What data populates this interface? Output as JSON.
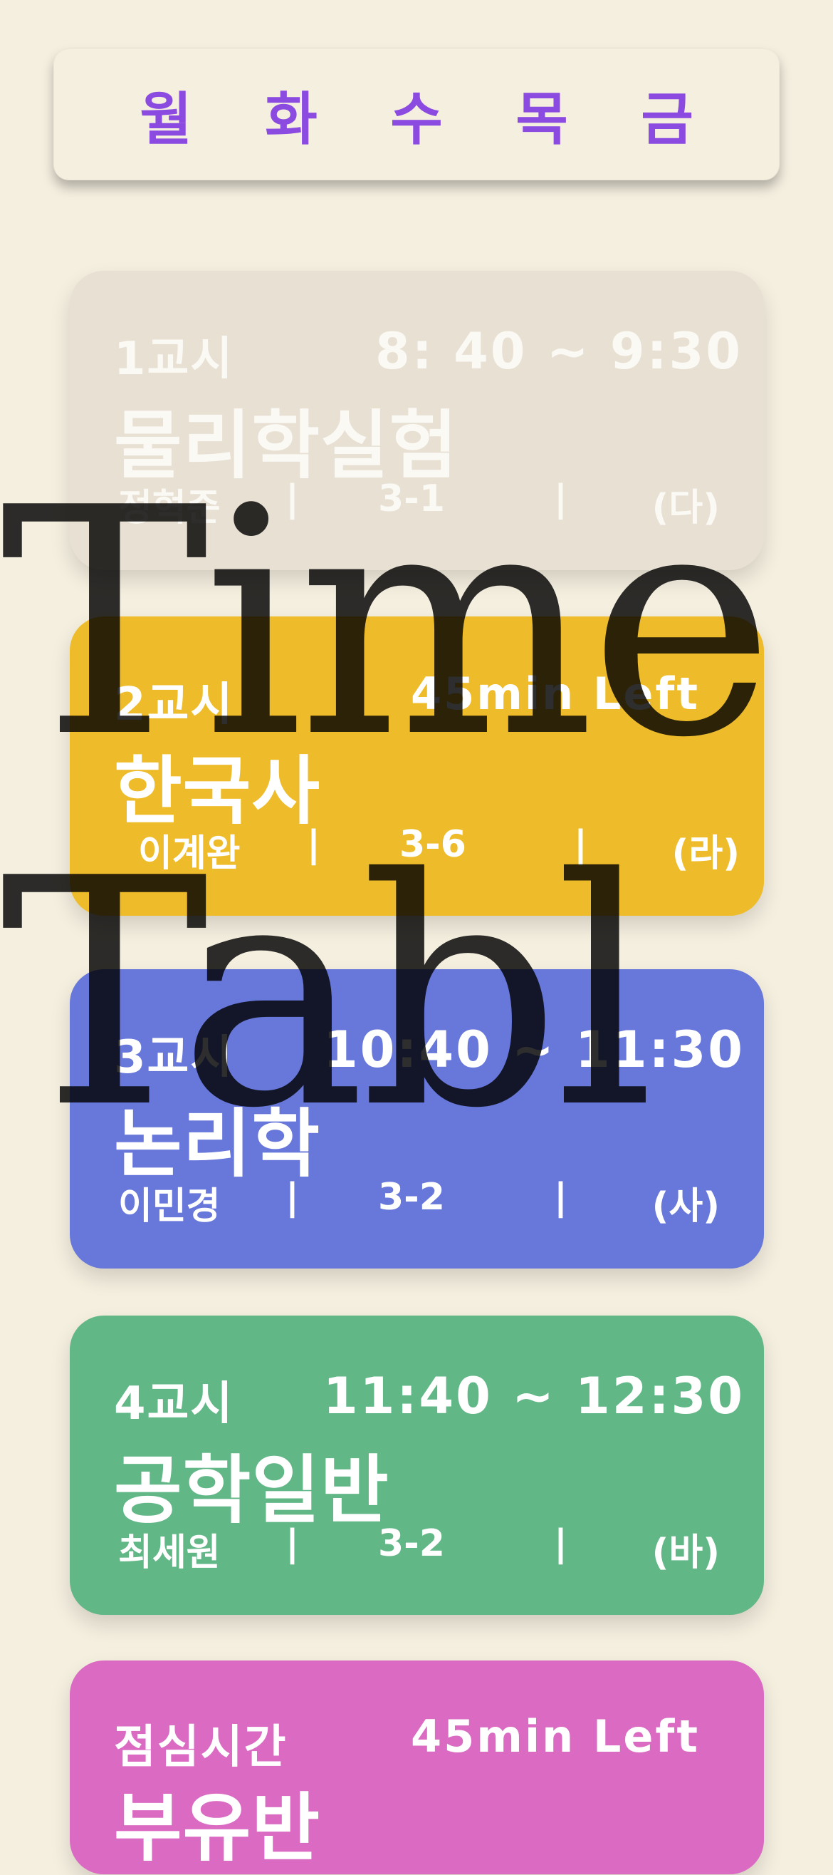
{
  "days": [
    "월",
    "화",
    "수",
    "목",
    "금"
  ],
  "watermark": {
    "line1": "Time",
    "line2": "Tabl"
  },
  "cards": [
    {
      "period": "1교시",
      "time": "8: 40 ~ 9:30",
      "subject": "물리학실험",
      "teacher": "정혁준",
      "sep1": "|",
      "room": "3-1",
      "sep2": "|",
      "code": "(다)",
      "color": "#e7e0d3"
    },
    {
      "period": "2교시",
      "time": "45min Left",
      "subject": "한국사",
      "teacher": "이계완",
      "sep1": "|",
      "room": "3-6",
      "sep2": "|",
      "code": "(라)",
      "color": "#eebc2a"
    },
    {
      "period": "3교시",
      "time": "10:40 ~ 11:30",
      "subject": "논리학",
      "teacher": "이민경",
      "sep1": "|",
      "room": "3-2",
      "sep2": "|",
      "code": "(사)",
      "color": "#6777da"
    },
    {
      "period": "4교시",
      "time": "11:40 ~ 12:30",
      "subject": "공학일반",
      "teacher": "최세원",
      "sep1": "|",
      "room": "3-2",
      "sep2": "|",
      "code": "(바)",
      "color": "#62b787"
    },
    {
      "period": "점심시간",
      "time": "45min Left",
      "subject": "부유반",
      "color": "#da6ac2"
    }
  ]
}
